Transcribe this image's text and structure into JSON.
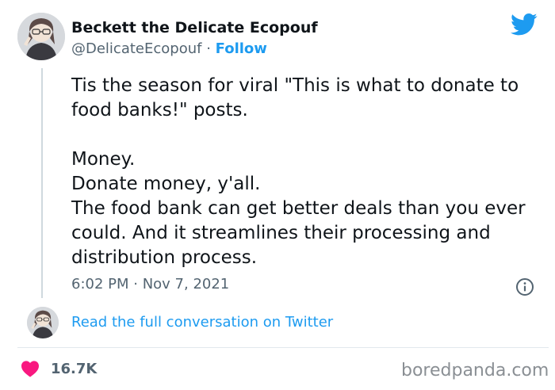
{
  "author": {
    "display_name": "Beckett the Delicate Ecopouf",
    "handle": "@DelicateEcopouf",
    "separator": " · ",
    "follow_label": "Follow"
  },
  "tweet": {
    "paragraph_1": "Tis the season for viral \"This is what to donate to food banks!\" posts.",
    "line_money": "Money.",
    "line_donate": "Donate money, y'all.",
    "line_body": "The food bank can get better deals than you ever could. And it streamlines their processing and distribution process.",
    "timestamp": "6:02 PM · Nov 7, 2021"
  },
  "conversation": {
    "link_label": "Read the full conversation on Twitter"
  },
  "engagement": {
    "likes": "16.7K"
  },
  "watermark": "boredpanda.com",
  "icons": {
    "brand": "twitter-bird-icon",
    "info": "info-icon",
    "like": "heart-icon"
  },
  "colors": {
    "accent_blue": "#1d9bf0",
    "heart_pink": "#f91880",
    "secondary_text": "#536471",
    "primary_text": "#0f1419"
  }
}
